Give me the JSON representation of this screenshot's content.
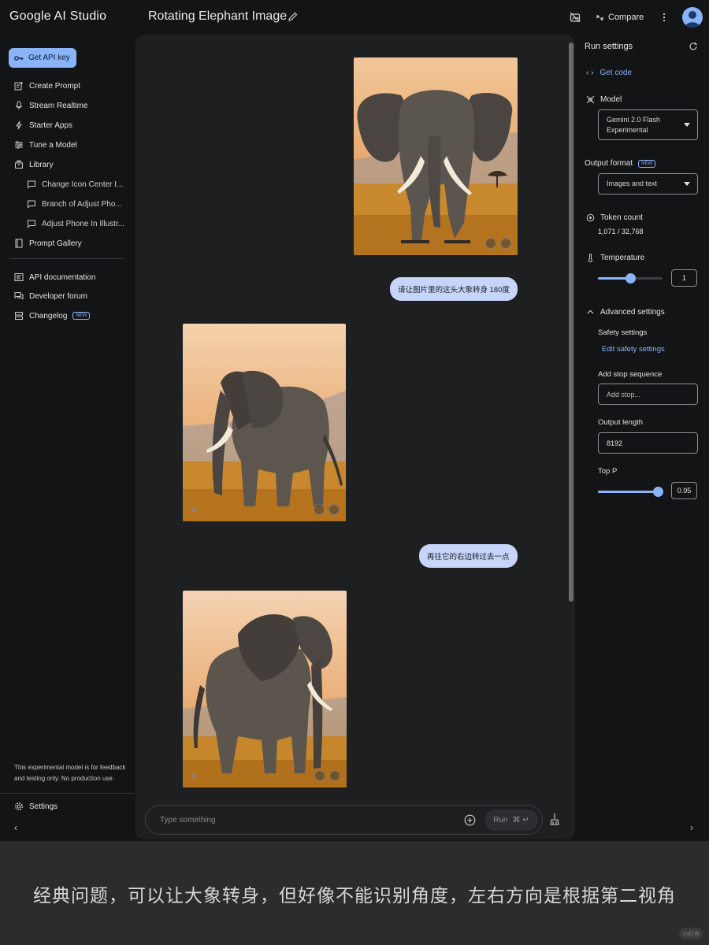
{
  "header": {
    "brand": "Google AI Studio",
    "title": "Rotating Elephant Image",
    "compare_label": "Compare"
  },
  "sidebar": {
    "api_key_label": "Get API key",
    "items": [
      {
        "label": "Create Prompt",
        "icon": "create-prompt-icon"
      },
      {
        "label": "Stream Realtime",
        "icon": "mic-icon"
      },
      {
        "label": "Starter Apps",
        "icon": "bolt-icon"
      },
      {
        "label": "Tune a Model",
        "icon": "tune-icon"
      },
      {
        "label": "Library",
        "icon": "library-icon"
      }
    ],
    "library": [
      "Change Icon Center I...",
      "Branch of Adjust Pho...",
      "Adjust Phone In Illustr..."
    ],
    "prompt_gallery": "Prompt Gallery",
    "links": [
      {
        "label": "API documentation",
        "icon": "api-doc-icon"
      },
      {
        "label": "Developer forum",
        "icon": "forum-icon"
      },
      {
        "label": "Changelog",
        "icon": "changelog-icon",
        "badge": "NEW"
      }
    ],
    "notice": "This experimental model is for feedback and testing only. No production use.",
    "settings_label": "Settings"
  },
  "chat": {
    "messages": [
      {
        "role": "user",
        "text": "请让图片里的这头大象转身 180度"
      },
      {
        "role": "user",
        "text": "再往它的右边转过去一点"
      }
    ],
    "input_placeholder": "Type something",
    "run_label": "Run",
    "run_shortcut": "⌘ ↵"
  },
  "run_settings": {
    "title": "Run settings",
    "get_code": "Get code",
    "model_label": "Model",
    "model_value_line1": "Gemini 2.0 Flash",
    "model_value_line2": "Experimental",
    "output_format_label": "Output format",
    "output_format_badge": "NEW",
    "output_format_value": "Images and text",
    "token_count_label": "Token count",
    "token_count_value": "1,071 / 32,768",
    "temperature_label": "Temperature",
    "temperature_value": "1",
    "temperature_fraction": 0.5,
    "advanced_label": "Advanced settings",
    "safety_label": "Safety settings",
    "safety_link": "Edit safety settings",
    "stop_label": "Add stop sequence",
    "stop_placeholder": "Add stop...",
    "output_length_label": "Output length",
    "output_length_value": "8192",
    "top_p_label": "Top P",
    "top_p_value": "0.95",
    "top_p_fraction": 0.95
  },
  "caption": "经典问题，可以让大象转身，但好像不能识别角度，左右方向是根据第二视角",
  "watermark": "小红书",
  "colors": {
    "accent": "#8ab4f8",
    "user_bubble": "#c7d5fb",
    "chat_bg": "#1e1f21",
    "app_bg": "#131416"
  }
}
